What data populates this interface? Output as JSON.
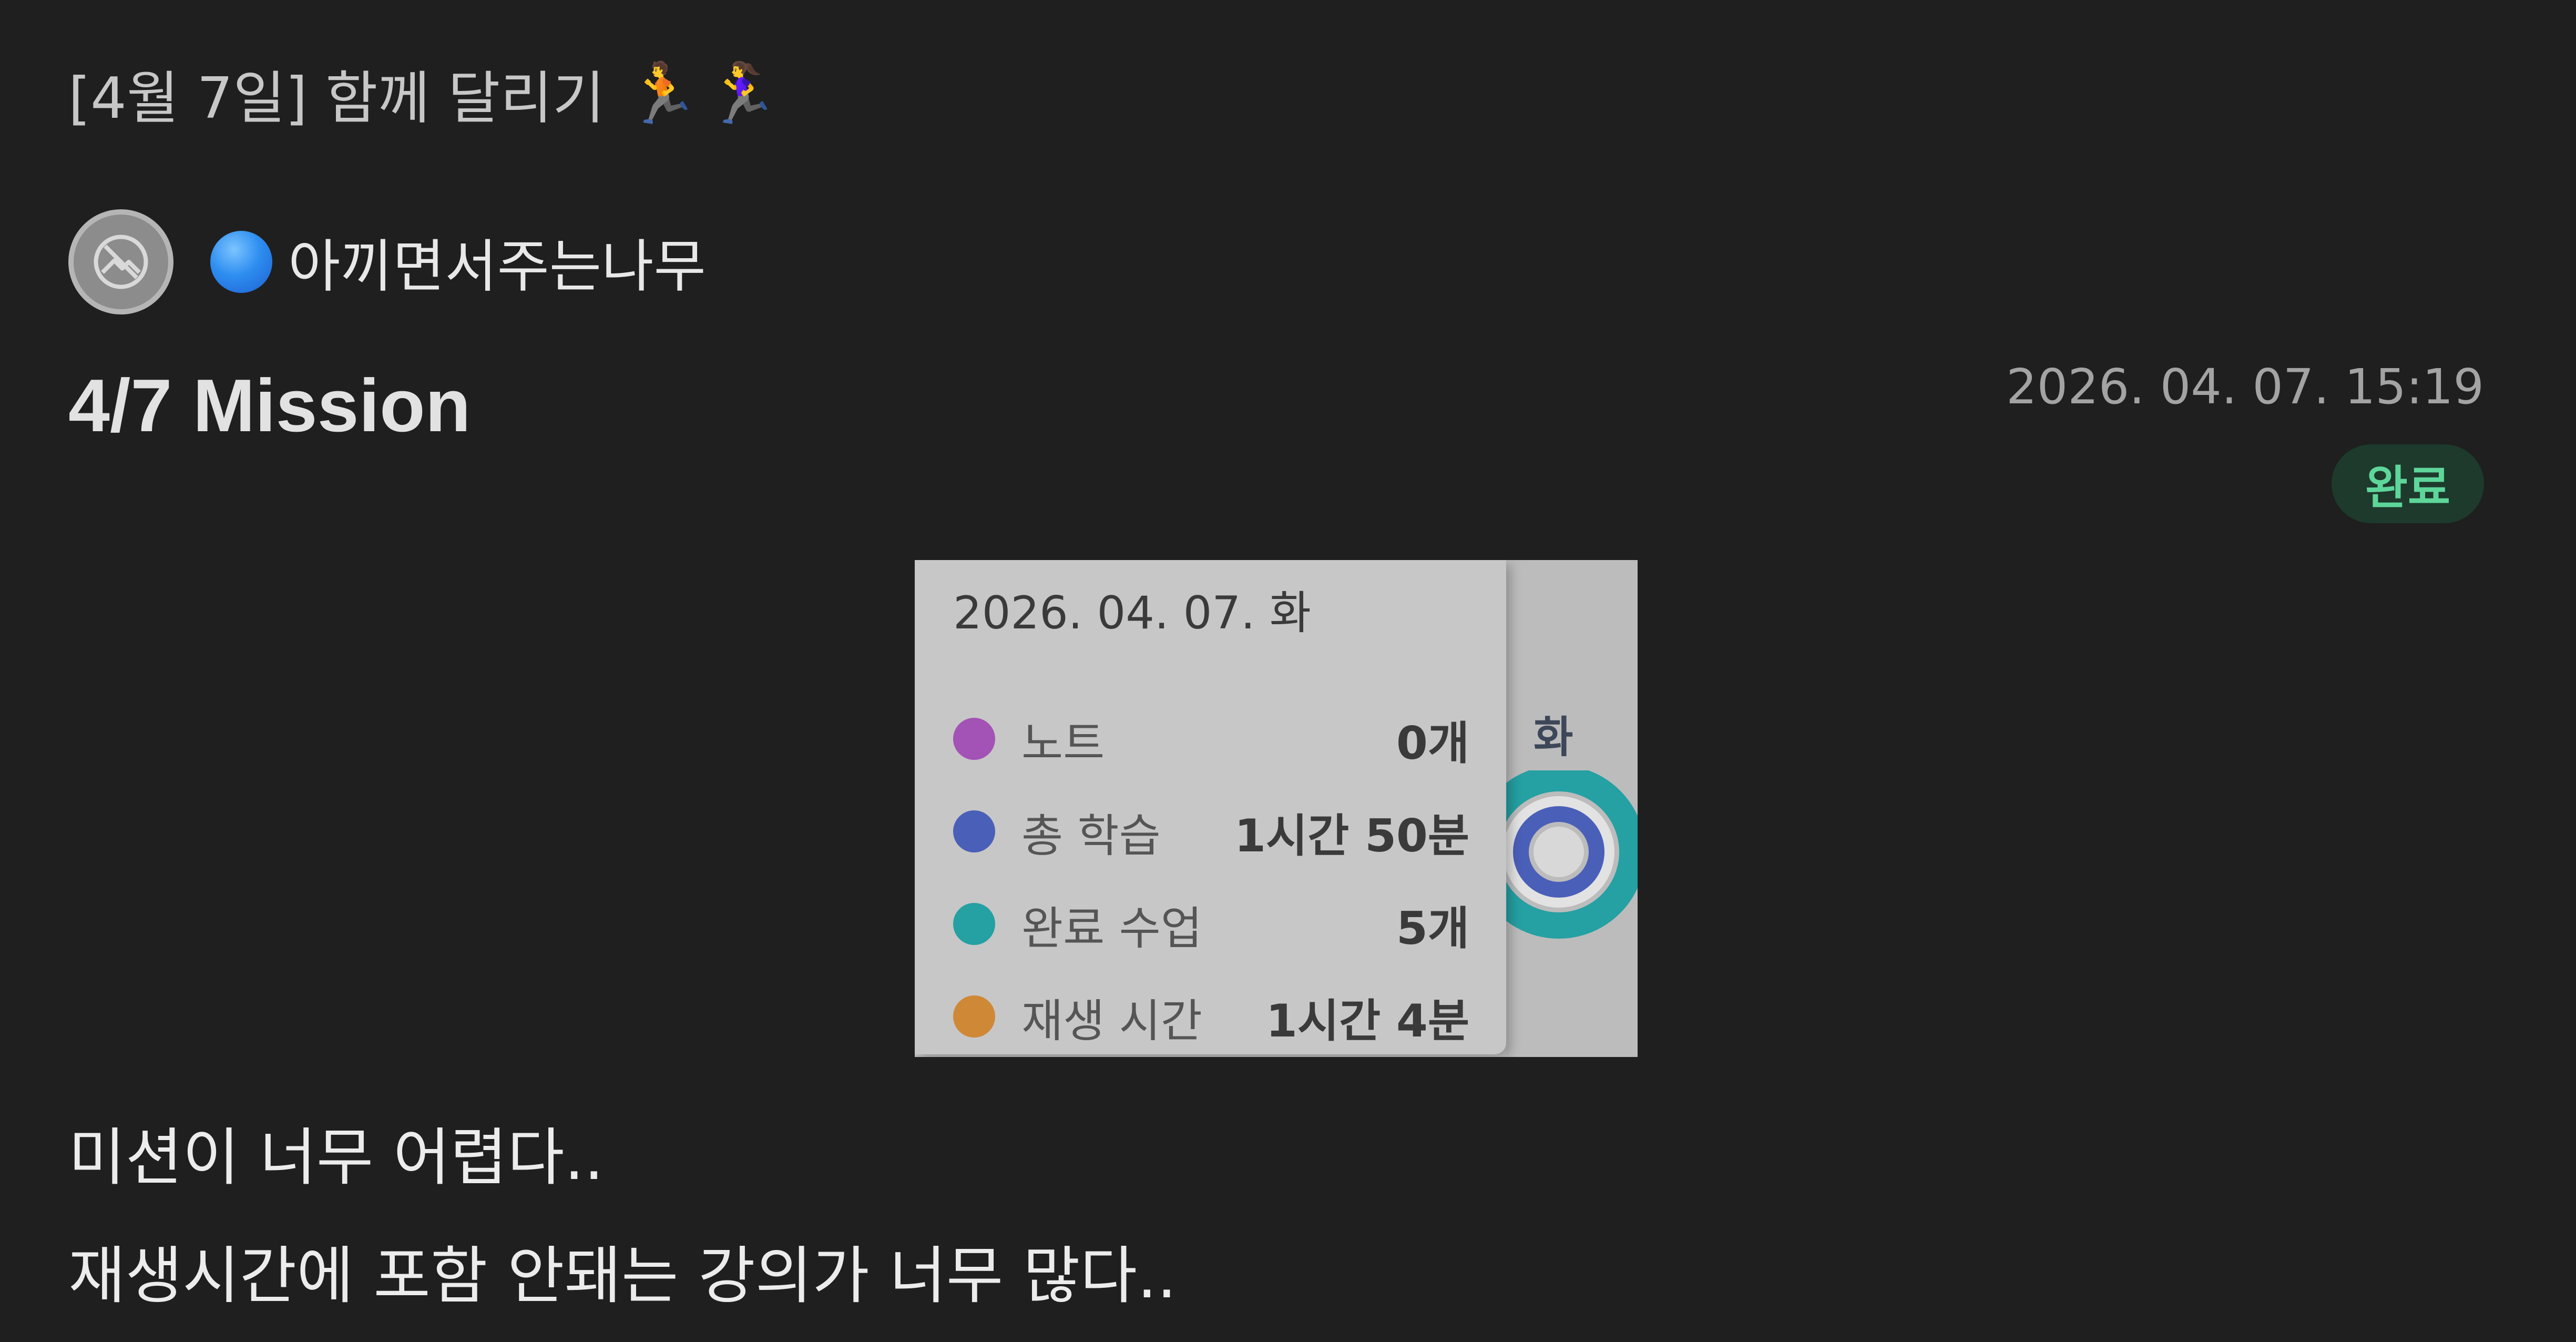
{
  "header": {
    "board_title": "[4월 7일] 함께 달리기",
    "icons": [
      "running-man-icon",
      "running-woman-icon"
    ]
  },
  "author": {
    "avatar_icon": "broken-image-icon",
    "badge_icon": "blue-circle-icon",
    "name": "아끼면서주는나무"
  },
  "post": {
    "title": "4/7 Mission",
    "timestamp": "2026. 04. 07. 15:19",
    "status": "완료",
    "body_lines": [
      "미션이 너무 어렵다..",
      "재생시간에 포함 안돼는 강의가 너무 많다.."
    ]
  },
  "embedded_image": {
    "date": "2026. 04. 07. 화",
    "day_label": "화",
    "stats": [
      {
        "label": "노트",
        "value": "0개",
        "color": "#a352b5"
      },
      {
        "label": "총 학습",
        "value": "1시간 50분",
        "color": "#4a5fb8"
      },
      {
        "label": "완료 수업",
        "value": "5개",
        "color": "#25a0a3"
      },
      {
        "label": "재생 시간",
        "value": "1시간 4분",
        "color": "#cf8836"
      }
    ]
  },
  "colors": {
    "background": "#1f1f1f",
    "status_bg": "#1d3a2c",
    "status_text": "#5ed69a"
  }
}
